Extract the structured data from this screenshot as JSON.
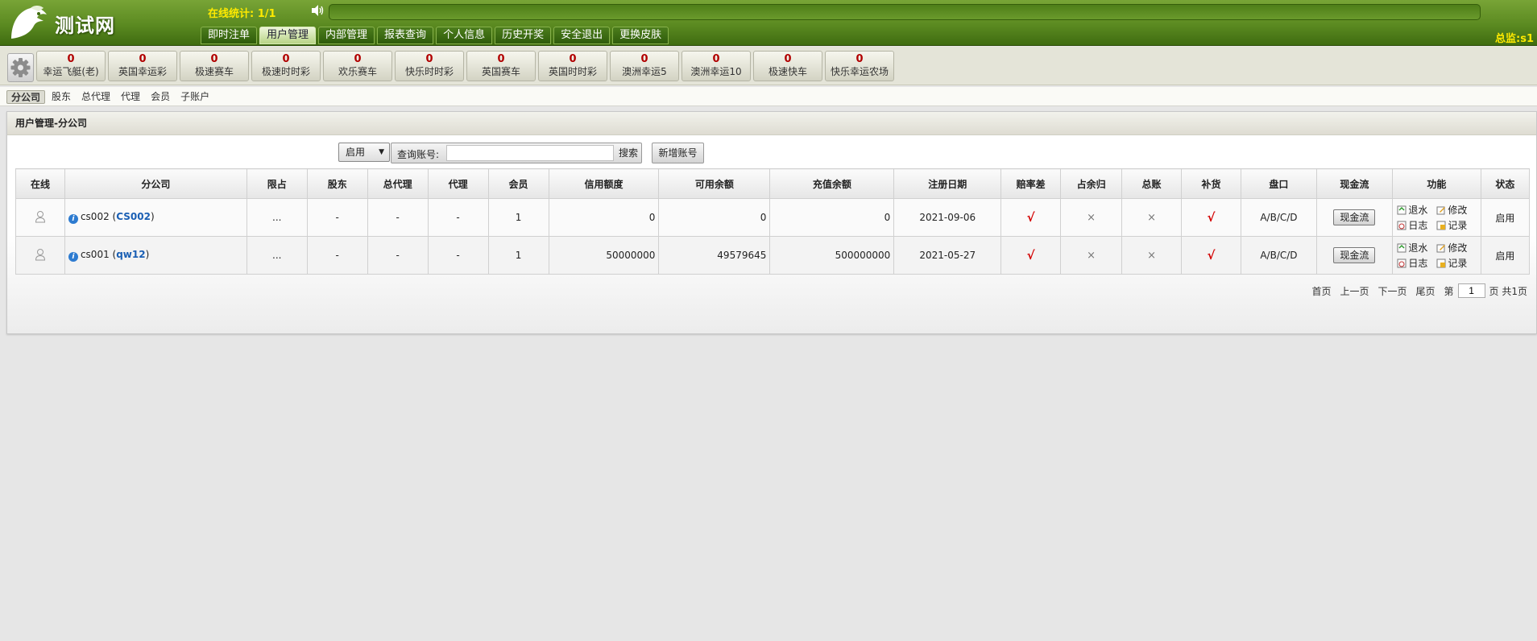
{
  "header": {
    "logo_text": "测试网",
    "online_stats": "在线统计: 1/1",
    "supervisor": "总监:s1",
    "nav": [
      "即时注单",
      "用户管理",
      "内部管理",
      "报表查询",
      "个人信息",
      "历史开奖",
      "安全退出",
      "更换皮肤"
    ],
    "active_nav": "用户管理"
  },
  "games": [
    {
      "count": "0",
      "name": "幸运飞艇(老)"
    },
    {
      "count": "0",
      "name": "英国幸运彩"
    },
    {
      "count": "0",
      "name": "极速赛车"
    },
    {
      "count": "0",
      "name": "极速时时彩"
    },
    {
      "count": "0",
      "name": "欢乐赛车"
    },
    {
      "count": "0",
      "name": "快乐时时彩"
    },
    {
      "count": "0",
      "name": "英国赛车"
    },
    {
      "count": "0",
      "name": "英国时时彩"
    },
    {
      "count": "0",
      "name": "澳洲幸运5"
    },
    {
      "count": "0",
      "name": "澳洲幸运10"
    },
    {
      "count": "0",
      "name": "极速快车"
    },
    {
      "count": "0",
      "name": "快乐幸运农场"
    }
  ],
  "subtabs": [
    "分公司",
    "股东",
    "总代理",
    "代理",
    "会员",
    "子账户"
  ],
  "panel": {
    "title": "用户管理-分公司",
    "status_select": "启用",
    "search_label": "查询账号:",
    "search_value": "",
    "search_button": "搜索",
    "add_button": "新增账号"
  },
  "table": {
    "columns": [
      "在线",
      "分公司",
      "限占",
      "股东",
      "总代理",
      "代理",
      "会员",
      "信用额度",
      "可用余额",
      "充值余额",
      "注册日期",
      "赔率差",
      "占余归",
      "总账",
      "补货",
      "盘口",
      "现金流",
      "功能",
      "状态"
    ],
    "rows": [
      {
        "account": "cs002",
        "nickname": "CS002",
        "limit": "...",
        "shareholder": "-",
        "general_agent": "-",
        "agent": "-",
        "members": "1",
        "credit": "0",
        "available": "0",
        "recharge": "0",
        "reg_date": "2021-09-06",
        "odds_diff": "√",
        "remainder": "×",
        "ledger": "×",
        "replenish": "√",
        "handicap": "A/B/C/D",
        "cash_flow": "现金流",
        "status": "启用"
      },
      {
        "account": "cs001",
        "nickname": "qw12",
        "limit": "...",
        "shareholder": "-",
        "general_agent": "-",
        "agent": "-",
        "members": "1",
        "credit": "50000000",
        "available": "49579645",
        "recharge": "500000000",
        "reg_date": "2021-05-27",
        "odds_diff": "√",
        "remainder": "×",
        "ledger": "×",
        "replenish": "√",
        "handicap": "A/B/C/D",
        "cash_flow": "现金流",
        "status": "启用"
      }
    ],
    "functions": {
      "rebate": "退水",
      "edit": "修改",
      "log": "日志",
      "record": "记录"
    }
  },
  "pager": {
    "first": "首页",
    "prev": "上一页",
    "next": "下一页",
    "last": "尾页",
    "page_prefix": "第",
    "page_value": "1",
    "page_suffix": "页 共1页"
  },
  "colors": {
    "header_green": "#5b8a21",
    "highlight_yellow": "#ffea00",
    "check_red": "#d30000",
    "count_red": "#b10000",
    "link_blue": "#1a5fb4"
  }
}
